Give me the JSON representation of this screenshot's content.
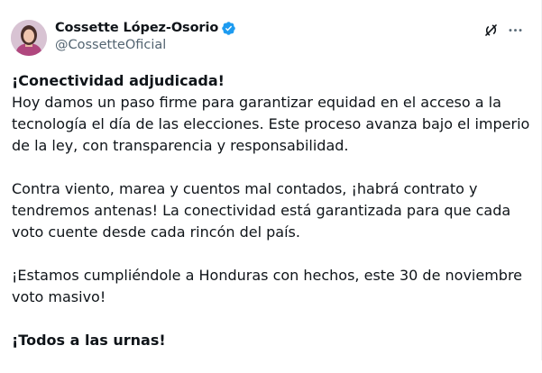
{
  "author": {
    "display_name": "Cossette López-Osorio",
    "handle": "@CossetteOficial",
    "verified": true,
    "verified_color": "#1d9bf0",
    "avatar_icon": "profile-photo"
  },
  "actions": {
    "grok_icon": "grok-icon",
    "more_icon": "more-horizontal-icon"
  },
  "tweet": {
    "title_line": "¡Conectividad adjudicada!",
    "p1_lines": [
      "Hoy damos un paso firme para garantizar equidad en el acceso a la",
      "tecnología el día de las elecciones. Este proceso avanza bajo el imperio",
      "de la ley, con transparencia y responsabilidad."
    ],
    "p2_lines": [
      "Contra viento, marea y cuentos mal contados, ¡habrá contrato y",
      "tendremos antenas! La conectividad está garantizada para que cada",
      "voto cuente desde cada rincón del país."
    ],
    "p3_lines": [
      "¡Estamos cumpliéndole a Honduras con hechos, este 30 de noviembre",
      "voto masivo!"
    ],
    "closing": "¡Todos a las urnas!"
  },
  "colors": {
    "text_primary": "#0f1419",
    "text_secondary": "#536471"
  }
}
